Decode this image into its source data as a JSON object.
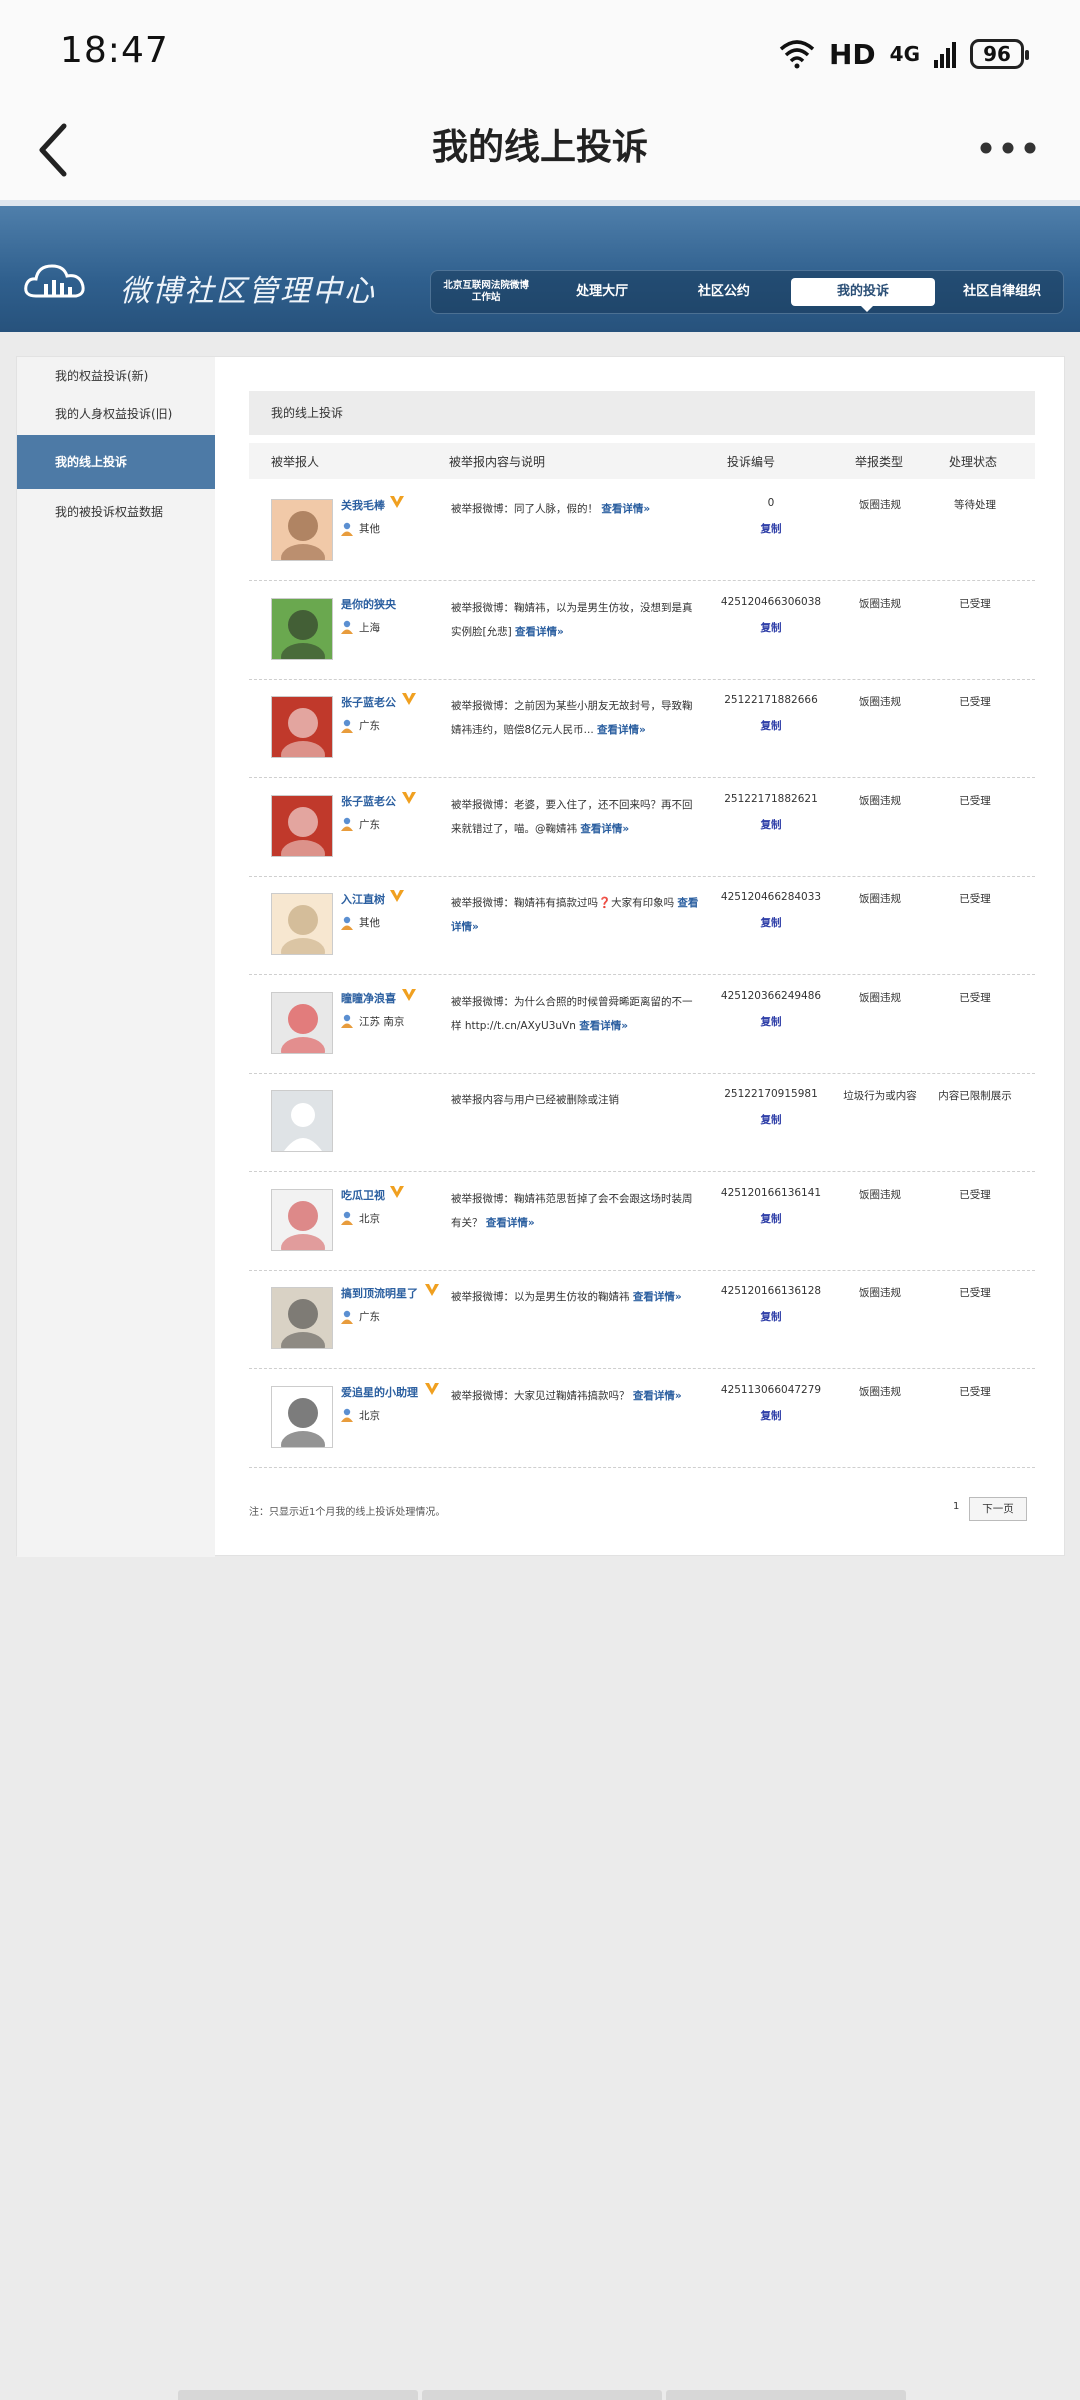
{
  "status_bar": {
    "time": "18:47",
    "hd": "HD",
    "network": "4G",
    "battery": "96"
  },
  "app_bar": {
    "title": "我的线上投诉"
  },
  "banner": {
    "brand": "微博社区管理中心",
    "nav": [
      {
        "line1": "北京互联网法院微博",
        "line2": "工作站"
      },
      {
        "label": "处理大厅"
      },
      {
        "label": "社区公约"
      },
      {
        "label": "我的投诉"
      },
      {
        "label": "社区自律组织"
      }
    ]
  },
  "sidebar": {
    "items": [
      {
        "label": "我的权益投诉(新)"
      },
      {
        "label": "我的人身权益投诉(旧)"
      },
      {
        "label": "我的线上投诉"
      },
      {
        "label": "我的被投诉权益数据"
      }
    ]
  },
  "main": {
    "section_title": "我的线上投诉",
    "columns": [
      "被举报人",
      "被举报内容与说明",
      "投诉编号",
      "举报类型",
      "处理状态"
    ],
    "view_detail": "查看详情»",
    "copy_label": "复制",
    "rows": [
      {
        "name": "关我毛棒",
        "verified": true,
        "location": "其他",
        "desc": "被举报微博：同了人脉，假的！",
        "case_no": "0",
        "type": "饭圈违规",
        "status": "等待处理"
      },
      {
        "name": "是你的狭央",
        "verified": false,
        "location": "上海",
        "desc": "被举报微博：鞠婧祎，以为是男生仿妆，没想到是真实例脸[允悲]",
        "case_no": "425120466306038",
        "type": "饭圈违规",
        "status": "已受理"
      },
      {
        "name": "张子蓝老公",
        "verified": true,
        "location": "广东",
        "desc": "被举报微博：之前因为某些小朋友无故封号，导致鞠婧祎违约，赔偿8亿元人民币...",
        "case_no": "25122171882666",
        "type": "饭圈违规",
        "status": "已受理"
      },
      {
        "name": "张子蓝老公",
        "verified": true,
        "location": "广东",
        "desc": "被举报微博：老婆，要入住了，还不回来吗？再不回来就错过了，喵。@鞠婧祎",
        "case_no": "25122171882621",
        "type": "饭圈违规",
        "status": "已受理"
      },
      {
        "name": "入江直树",
        "verified": true,
        "location": "其他",
        "desc": "被举报微博：鞠婧祎有搞款过吗❓大家有印象吗",
        "case_no": "425120466284033",
        "type": "饭圈违规",
        "status": "已受理"
      },
      {
        "name": "瞳瞳净浪喜",
        "verified": true,
        "location": "江苏 南京",
        "desc": "被举报微博：为什么合照的时候曾舜晞距离留的不一样 http://t.cn/AXyU3uVn",
        "case_no": "425120366249486",
        "type": "饭圈违规",
        "status": "已受理"
      },
      {
        "name": "",
        "verified": false,
        "location": "",
        "desc": "被举报内容与用户已经被删除或注销",
        "case_no": "25122170915981",
        "type": "垃圾行为或内容",
        "status": "内容已限制展示"
      },
      {
        "name": "吃瓜卫视",
        "verified": true,
        "location": "北京",
        "desc": "被举报微博：鞠婧祎范思哲掉了会不会跟这场时装周有关？",
        "case_no": "425120166136141",
        "type": "饭圈违规",
        "status": "已受理"
      },
      {
        "name": "搞到顶流明星了",
        "verified": true,
        "location": "广东",
        "desc": "被举报微博：以为是男生仿妆的鞠婧祎",
        "case_no": "425120166136128",
        "type": "饭圈违规",
        "status": "已受理"
      },
      {
        "name": "爱追星的小助理",
        "verified": true,
        "location": "北京",
        "desc": "被举报微博：大家见过鞠婧祎搞款吗？",
        "case_no": "425113066047279",
        "type": "饭圈违规",
        "status": "已受理"
      }
    ],
    "note": "注：只显示近1个月我的线上投诉处理情况。",
    "pagination": {
      "page": "1",
      "next_label": "下一页"
    }
  },
  "colors": {
    "banner": "#2f5f8d",
    "sidebar_active": "#4d7aa6",
    "link": "#2b5fa0",
    "copy": "#2f3fa8",
    "verified_badge": "#f0a020"
  }
}
